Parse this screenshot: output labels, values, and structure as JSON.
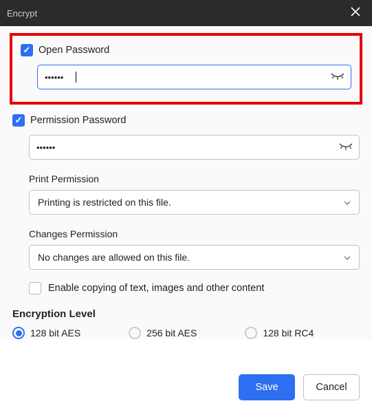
{
  "title": "Encrypt",
  "open_password": {
    "label": "Open Password",
    "checked": true,
    "value": "••••••"
  },
  "permission_password": {
    "label": "Permission Password",
    "checked": true,
    "value": "••••••"
  },
  "print_permission": {
    "label": "Print Permission",
    "value": "Printing is restricted on this file."
  },
  "changes_permission": {
    "label": "Changes Permission",
    "value": "No changes are allowed on this file."
  },
  "enable_copy": {
    "label": "Enable copying of text, images and other content",
    "checked": false
  },
  "encryption": {
    "title": "Encryption Level",
    "options": [
      "128 bit AES",
      "256 bit AES",
      "128 bit RC4"
    ],
    "selected_index": 0
  },
  "buttons": {
    "save": "Save",
    "cancel": "Cancel"
  }
}
